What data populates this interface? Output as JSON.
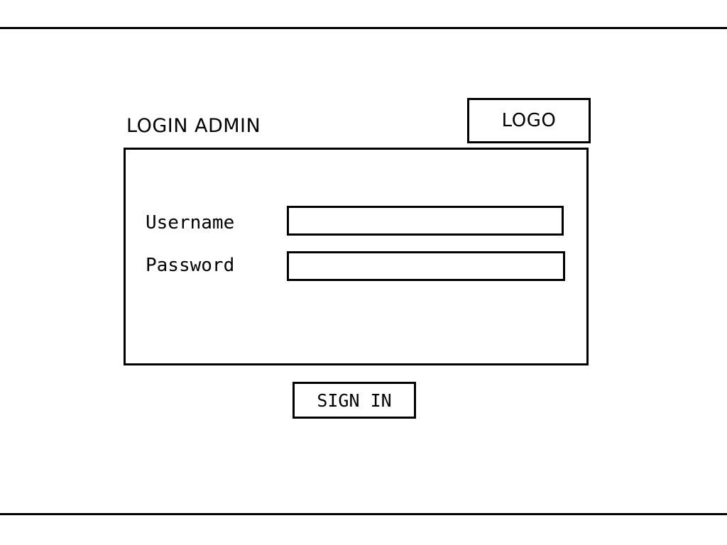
{
  "header": {
    "title": "LOGIN ADMIN",
    "logo_text": "LOGO"
  },
  "form": {
    "username_label": "Username",
    "username_value": "",
    "password_label": "Password",
    "password_value": ""
  },
  "actions": {
    "sign_in_label": "SIGN IN"
  },
  "colors": {
    "background": "#ffffff",
    "stroke": "#000000"
  }
}
